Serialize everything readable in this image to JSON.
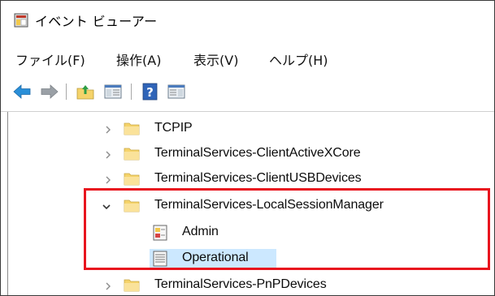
{
  "window": {
    "title": "イベント ビューアー"
  },
  "menu": [
    {
      "label": "ファイル(F)"
    },
    {
      "label": "操作(A)"
    },
    {
      "label": "表示(V)"
    },
    {
      "label": "ヘルプ(H)"
    }
  ],
  "toolbar": {
    "buttons": [
      "back-arrow-icon",
      "forward-arrow-icon",
      "up-folder-icon",
      "show-hide-tree-icon",
      "help-icon",
      "show-hide-action-pane-icon"
    ]
  },
  "tree": {
    "items": [
      {
        "label": "TCPIP",
        "expanded": false
      },
      {
        "label": "TerminalServices-ClientActiveXCore",
        "expanded": false
      },
      {
        "label": "TerminalServices-ClientUSBDevices",
        "expanded": false
      },
      {
        "label": "TerminalServices-LocalSessionManager",
        "expanded": true,
        "children": [
          {
            "label": "Admin",
            "icon": "admin-log-icon"
          },
          {
            "label": "Operational",
            "icon": "operational-log-icon",
            "selected": true
          }
        ]
      },
      {
        "label": "TerminalServices-PnPDevices",
        "expanded": false
      }
    ]
  },
  "annotation": {
    "color": "#e8141e"
  },
  "colors": {
    "selection": "#cce8ff",
    "folder": "#f5d36a",
    "arrow": "#2a8fd8"
  }
}
